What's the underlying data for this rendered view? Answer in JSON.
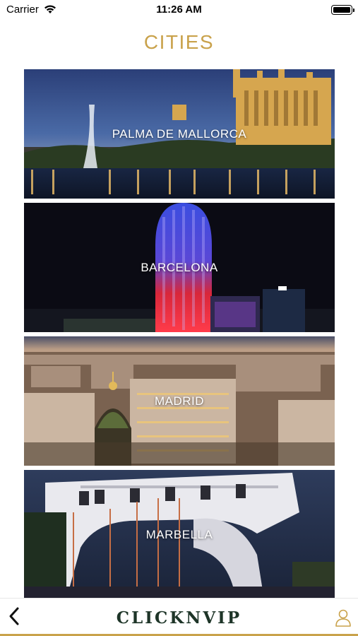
{
  "status_bar": {
    "carrier": "Carrier",
    "time": "11:26 AM"
  },
  "header": {
    "title": "CITIES"
  },
  "cities": [
    {
      "name": "PALMA DE MALLORCA"
    },
    {
      "name": "BARCELONA"
    },
    {
      "name": "MADRID"
    },
    {
      "name": "MARBELLA"
    }
  ],
  "bottom_bar": {
    "brand": "CLICKNVIP",
    "back_icon": "chevron-left-icon",
    "user_icon": "user-icon"
  },
  "colors": {
    "accent_gold": "#c9a24b",
    "brand_green": "#1e3528"
  }
}
